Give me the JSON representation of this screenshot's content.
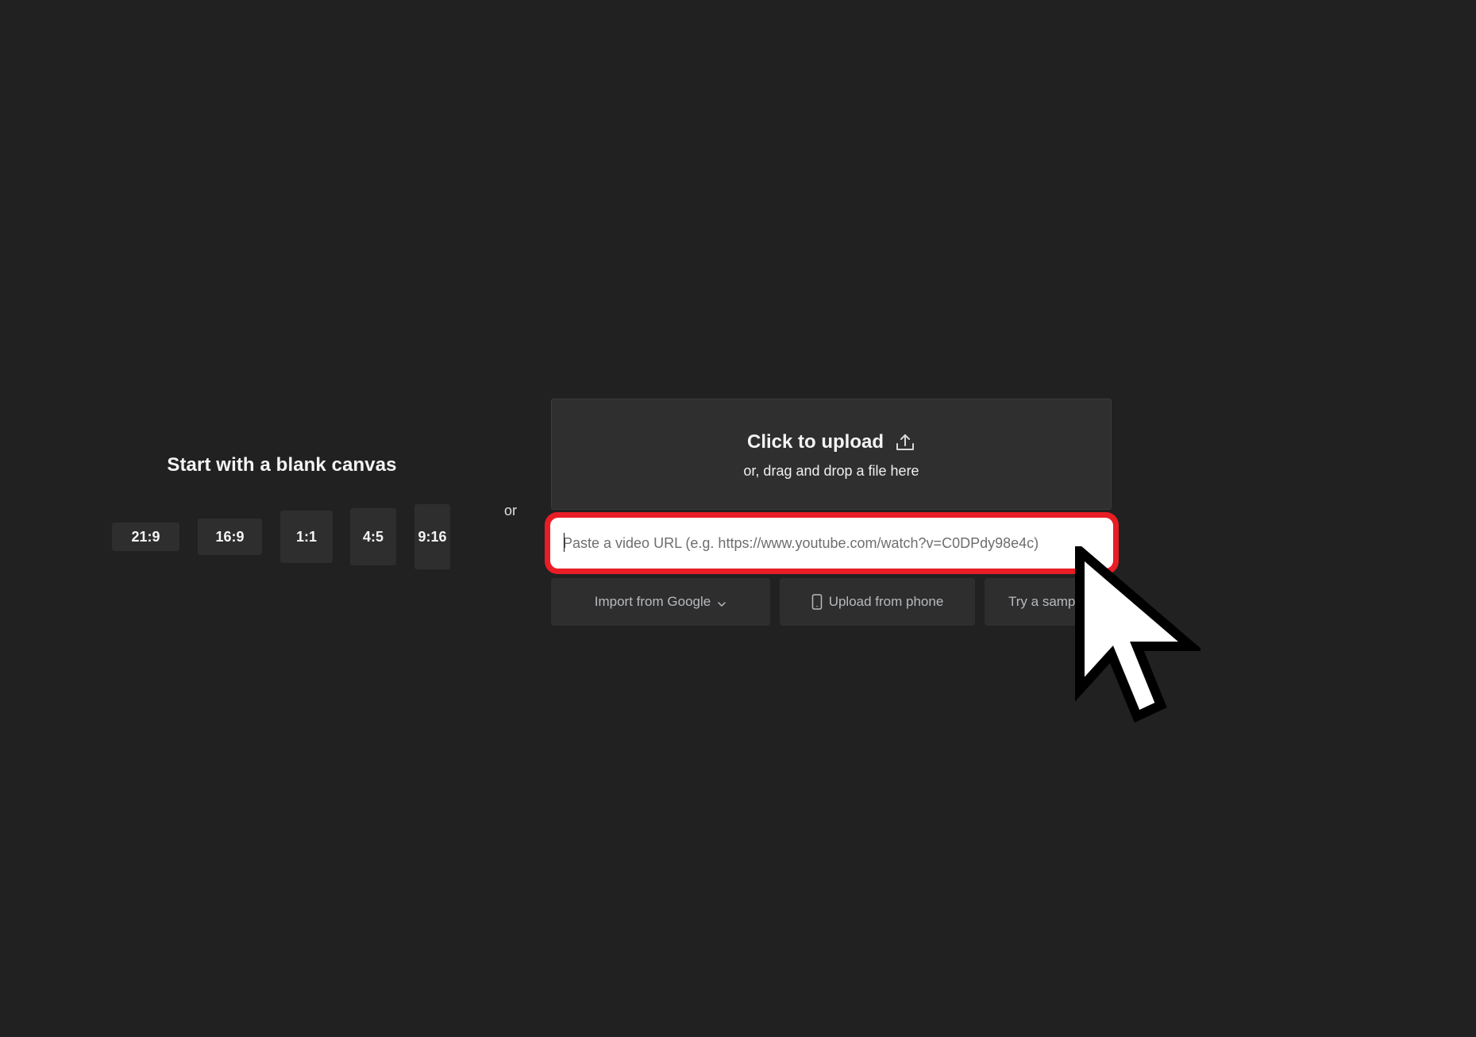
{
  "blank_canvas": {
    "title": "Start with a blank canvas",
    "ratios": [
      {
        "label": "21:9"
      },
      {
        "label": "16:9"
      },
      {
        "label": "1:1"
      },
      {
        "label": "4:5"
      },
      {
        "label": "9:16"
      }
    ]
  },
  "separator": {
    "label": "or"
  },
  "upload": {
    "title": "Click to upload",
    "subtitle": "or, drag and drop a file here",
    "icon": "upload-icon"
  },
  "url_input": {
    "value": "",
    "placeholder": "Paste a video URL (e.g. https://www.youtube.com/watch?v=C0DPdy98e4c)",
    "highlight_color": "#e81d25"
  },
  "actions": {
    "import_google": {
      "label": "Import from Google",
      "icon": "chevron-down-icon"
    },
    "upload_phone": {
      "label": "Upload from phone",
      "icon": "phone-icon"
    },
    "try_sample": {
      "label": "Try a sample"
    }
  },
  "colors": {
    "background": "#212121",
    "panel": "#2f2f2f",
    "button": "#2e2e2e",
    "muted_text": "#b7babf"
  }
}
